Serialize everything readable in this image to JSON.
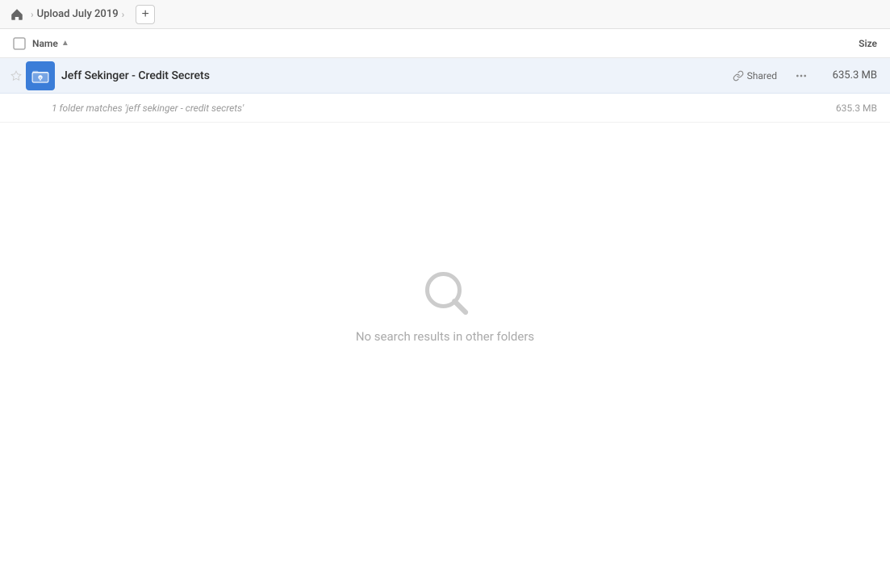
{
  "breadcrumb": {
    "home_label": "Home",
    "current_folder": "Upload July 2019",
    "add_button_label": "+"
  },
  "columns": {
    "name_label": "Name",
    "size_label": "Size"
  },
  "file_row": {
    "name": "Jeff Sekinger - Credit Secrets",
    "shared_label": "Shared",
    "size": "635.3 MB",
    "more_icon": "···"
  },
  "match_info": {
    "text": "1 folder matches 'jeff sekinger - credit secrets'",
    "size": "635.3 MB"
  },
  "empty_state": {
    "message": "No search results in other folders"
  },
  "icons": {
    "home": "⌂",
    "chevron": "›",
    "star_empty": "☆",
    "link": "🔗",
    "more": "•••"
  }
}
